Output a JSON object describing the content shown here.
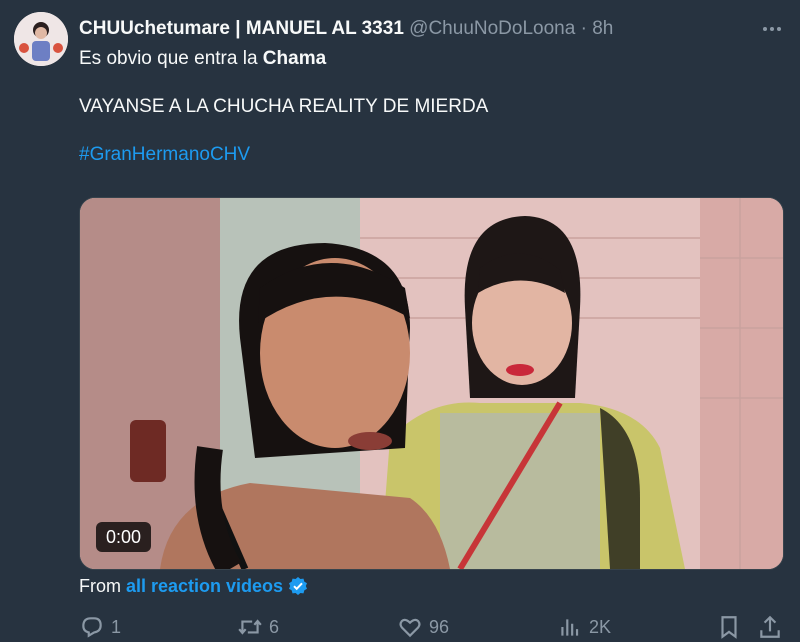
{
  "tweet": {
    "display_name": "CHUUchetumare | MANUEL AL 3331",
    "handle": "@ChuuNoDoLoona",
    "separator": "·",
    "time": "8h",
    "text_line1_prefix": "Es obvio que entra la ",
    "text_line1_bold": "Chama",
    "text_line2": "VAYANSE A LA CHUCHA REALITY DE MIERDA",
    "hashtag": "#GranHermanoCHV"
  },
  "video": {
    "timestamp": "0:00"
  },
  "attribution": {
    "prefix": "From",
    "source": "all reaction videos"
  },
  "actions": {
    "reply_count": "1",
    "retweet_count": "6",
    "like_count": "96",
    "view_count": "2K"
  },
  "colors": {
    "background": "#273340",
    "text": "#f7f9f9",
    "secondary": "#8b98a5",
    "accent": "#1d9bf0"
  },
  "icons": [
    "more-icon",
    "reply-icon",
    "retweet-icon",
    "like-icon",
    "views-icon",
    "bookmark-icon",
    "share-icon",
    "verified-badge-icon"
  ]
}
